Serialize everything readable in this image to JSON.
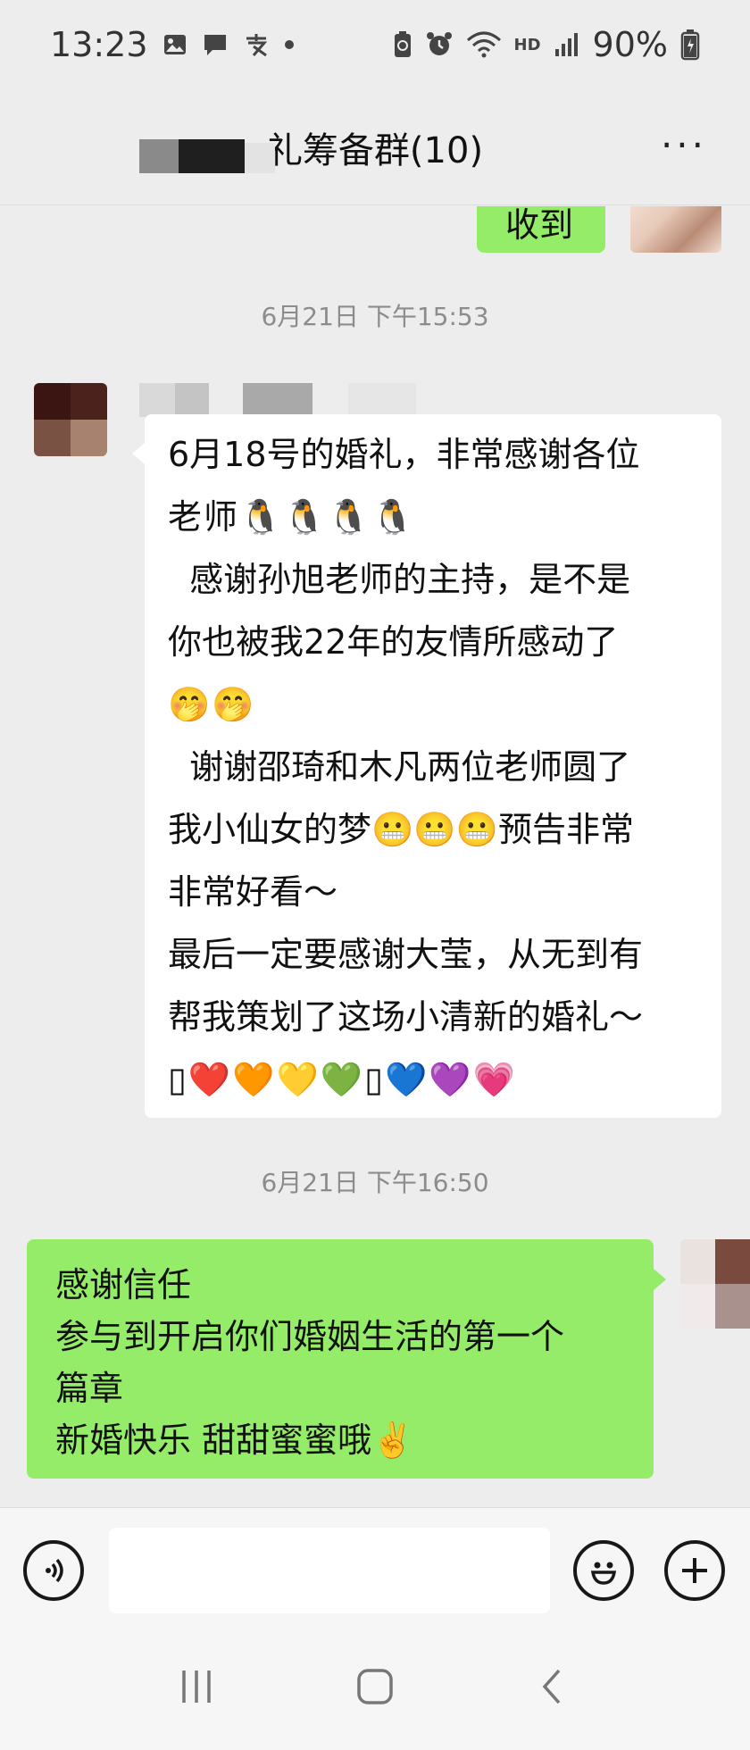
{
  "status_bar": {
    "time": "13:23",
    "left_icons": [
      "image-icon",
      "message-icon",
      "alipay-icon",
      "dot-icon"
    ],
    "right_icons": [
      "battery-saver-icon",
      "alarm-icon",
      "wifi-icon",
      "hd-icon",
      "signal-icon"
    ],
    "hd_label": "HD",
    "battery_percent": "90%"
  },
  "header": {
    "title": "礼筹备群(10)",
    "more_label": "···"
  },
  "messages": [
    {
      "type": "sent",
      "text": "收到"
    },
    {
      "type": "time",
      "text": "6月21日 下午15:53"
    },
    {
      "type": "received",
      "lines": [
        "6月18号的婚礼，非常感谢各位",
        "老师🐧🐧🐧🐧",
        "  感谢孙旭老师的主持，是不是",
        "你也被我22年的友情所感动了",
        "🤭🤭",
        "  谢谢邵琦和木凡两位老师圆了",
        "我小仙女的梦😬😬😬预告非常",
        "非常好看～",
        "最后一定要感谢大莹，从无到有",
        "帮我策划了这场小清新的婚礼～",
        "▯❤️🧡💛💚▯💙💜💗"
      ]
    },
    {
      "type": "time",
      "text": "6月21日 下午16:50"
    },
    {
      "type": "sent",
      "lines": [
        "感谢信任",
        "参与到开启你们婚姻生活的第一个",
        "篇章",
        "新婚快乐 甜甜蜜蜜哦✌️"
      ]
    }
  ],
  "input_bar": {
    "voice_icon": "voice-icon",
    "emoji_icon": "emoji-icon",
    "plus_icon": "plus-icon",
    "voice_glyph": "🔊",
    "emoji_glyph": "☺",
    "plus_glyph": "+"
  },
  "nav_bar": {
    "recents_glyph": "|||",
    "home_glyph": "▢",
    "back_glyph": "‹"
  },
  "colors": {
    "background": "#ededed",
    "sent_bubble": "#95ec69",
    "received_bubble": "#ffffff",
    "time_text": "#8c8c8c"
  }
}
